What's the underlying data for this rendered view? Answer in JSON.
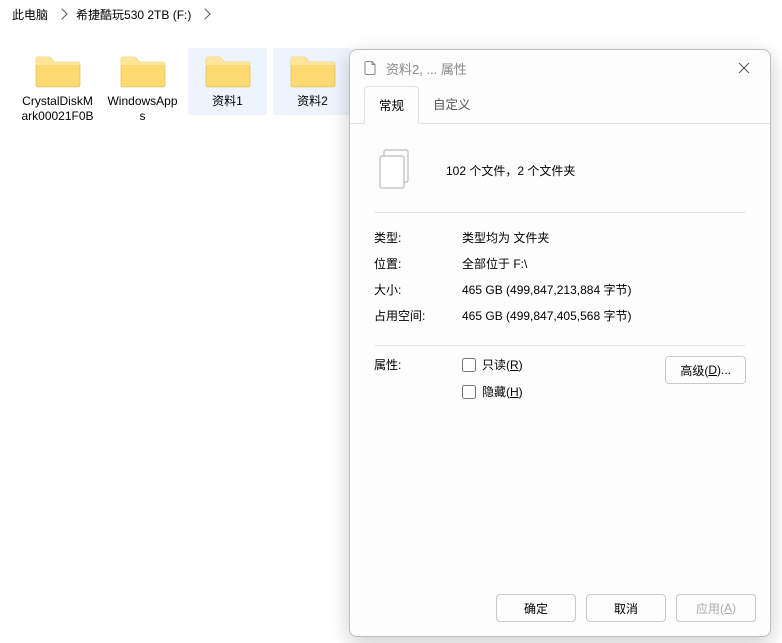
{
  "breadcrumb": {
    "root": "此电脑",
    "drive": "希捷酷玩530 2TB (F:)"
  },
  "folders": [
    {
      "name": "CrystalDiskMark00021F0B",
      "selected": false
    },
    {
      "name": "WindowsApps",
      "selected": false
    },
    {
      "name": "资料1",
      "selected": true
    },
    {
      "name": "资料2",
      "selected": true
    }
  ],
  "dialog": {
    "title": "资料2, ... 属性",
    "tabs": {
      "general": "常规",
      "custom": "自定义"
    },
    "active_tab": "general",
    "summary": "102 个文件，2 个文件夹",
    "type_label": "类型:",
    "type_value": "类型均为 文件夹",
    "location_label": "位置:",
    "location_value": "全部位于 F:\\",
    "size_label": "大小:",
    "size_value": "465 GB (499,847,213,884 字节)",
    "disk_label": "占用空间:",
    "disk_value": "465 GB (499,847,405,568 字节)",
    "attr_label": "属性:",
    "readonly_label_pre": "只读(",
    "readonly_key": "R",
    "readonly_label_post": ")",
    "hidden_label_pre": "隐藏(",
    "hidden_key": "H",
    "hidden_label_post": ")",
    "advanced_pre": "高级(",
    "advanced_key": "D",
    "advanced_post": ")...",
    "buttons": {
      "ok": "确定",
      "cancel": "取消",
      "apply_pre": "应用(",
      "apply_key": "A",
      "apply_post": ")"
    }
  }
}
